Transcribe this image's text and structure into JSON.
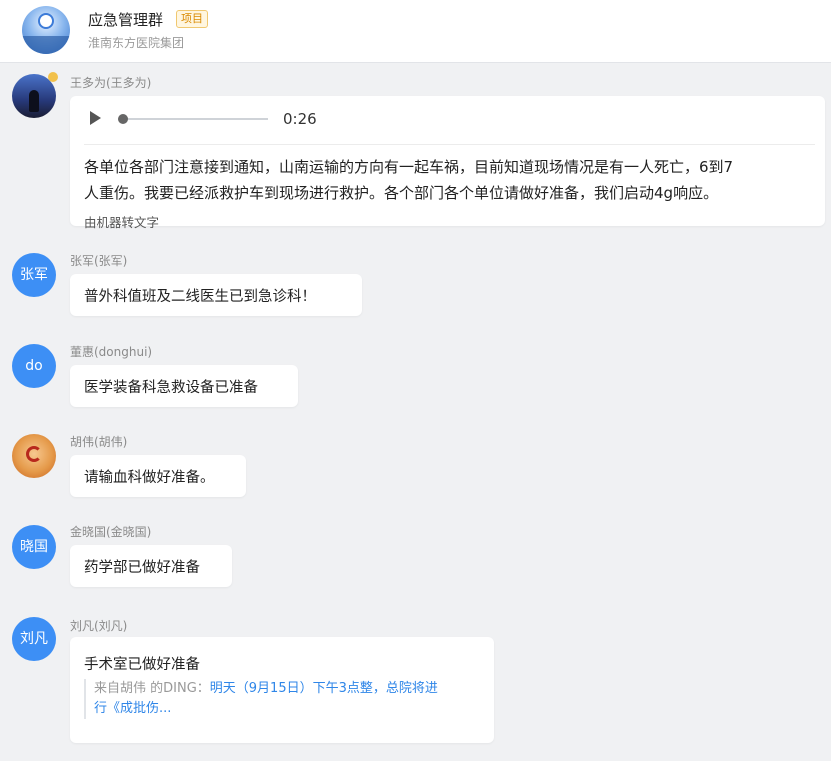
{
  "group": {
    "title": "应急管理群",
    "tag": "项目",
    "org": "淮南东方医院集团"
  },
  "messages": [
    {
      "sender": "王多为(王多为)",
      "voice": {
        "duration": "0:26",
        "progress": 0
      },
      "transcript": {
        "line1": "各单位各部门注意接到通知，山南运输的方向有一起车祸，目前知道现场情况是有一人死亡，6到7",
        "line2": "人重伤。我要已经派救护车到现场进行救护。各个部门各个单位请做好准备，我们启动4g响应。",
        "note": "由机器转文字"
      }
    },
    {
      "avatar_text": "张军",
      "sender": "张军(张军)",
      "text": "普外科值班及二线医生已到急诊科！"
    },
    {
      "avatar_text": "do",
      "sender": "董惠(donghui)",
      "text": "医学装备科急救设备已准备"
    },
    {
      "sender": "胡伟(胡伟)",
      "text": "请输血科做好准备。"
    },
    {
      "avatar_text": "晓国",
      "sender": "金晓国(金晓国)",
      "text": "药学部已做好准备"
    },
    {
      "avatar_text": "刘凡",
      "sender": "刘凡(刘凡)",
      "text": "手术室已做好准备",
      "quote": {
        "prefix": "来自胡伟 的DING：",
        "link_line1": "明天（9月15日）下午3点整，总院将进",
        "link_line2": "行《成批伤..."
      }
    }
  ],
  "colors": {
    "avatar_blue": "#3d8ff5",
    "link_blue": "#2f86e8",
    "tag_orange": "#d98a00",
    "background": "#f0f1f3"
  },
  "icons": {
    "play": "play-icon"
  }
}
